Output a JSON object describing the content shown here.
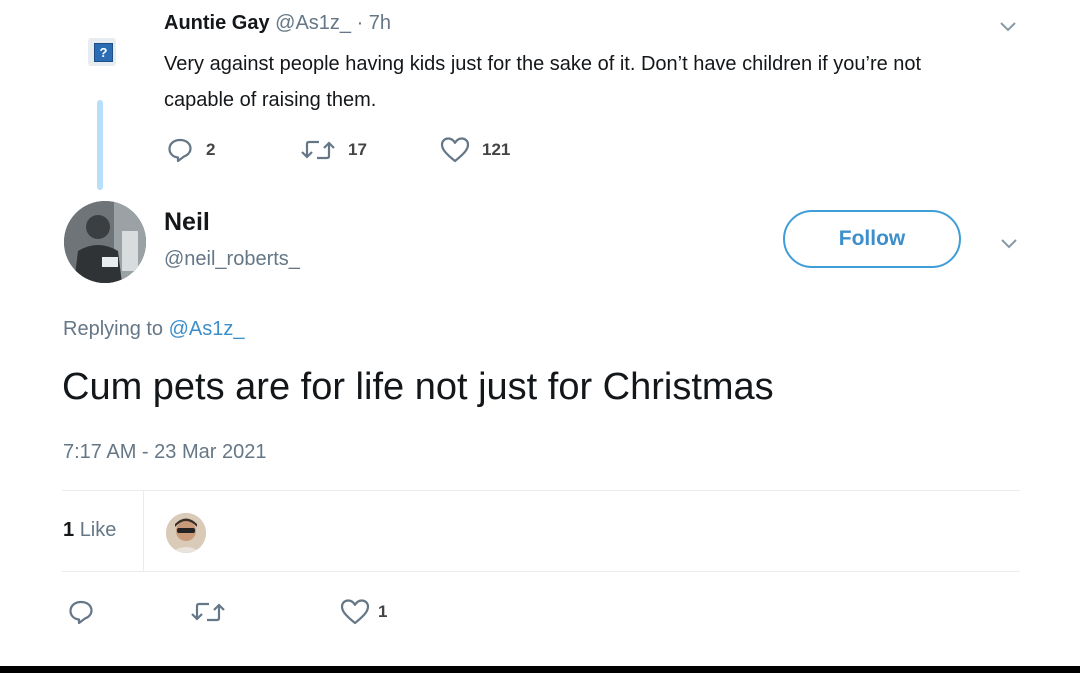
{
  "parent_tweet": {
    "avatar_icon": "unknown-question-icon",
    "name": "Auntie Gay",
    "handle": "@As1z_",
    "time": "· 7h",
    "text": "Very against people having kids just for the sake of it. Don’t have children if you’re not capable of raising them.",
    "replies": "2",
    "retweets": "17",
    "likes": "121"
  },
  "main_tweet": {
    "name": "Neil",
    "handle": "@neil_roberts_",
    "follow_label": "Follow",
    "replying_prefix": "Replying to ",
    "replying_to": "@As1z_",
    "text": "Cum pets are for life not just for Christmas",
    "timestamp": "7:17 AM - 23 Mar 2021",
    "like_count": "1",
    "like_label": "Like",
    "action_like_count": "1"
  },
  "colors": {
    "accent": "#3c8fca",
    "muted": "#657786",
    "thread_line": "#b7dff9",
    "text": "#14171a"
  }
}
